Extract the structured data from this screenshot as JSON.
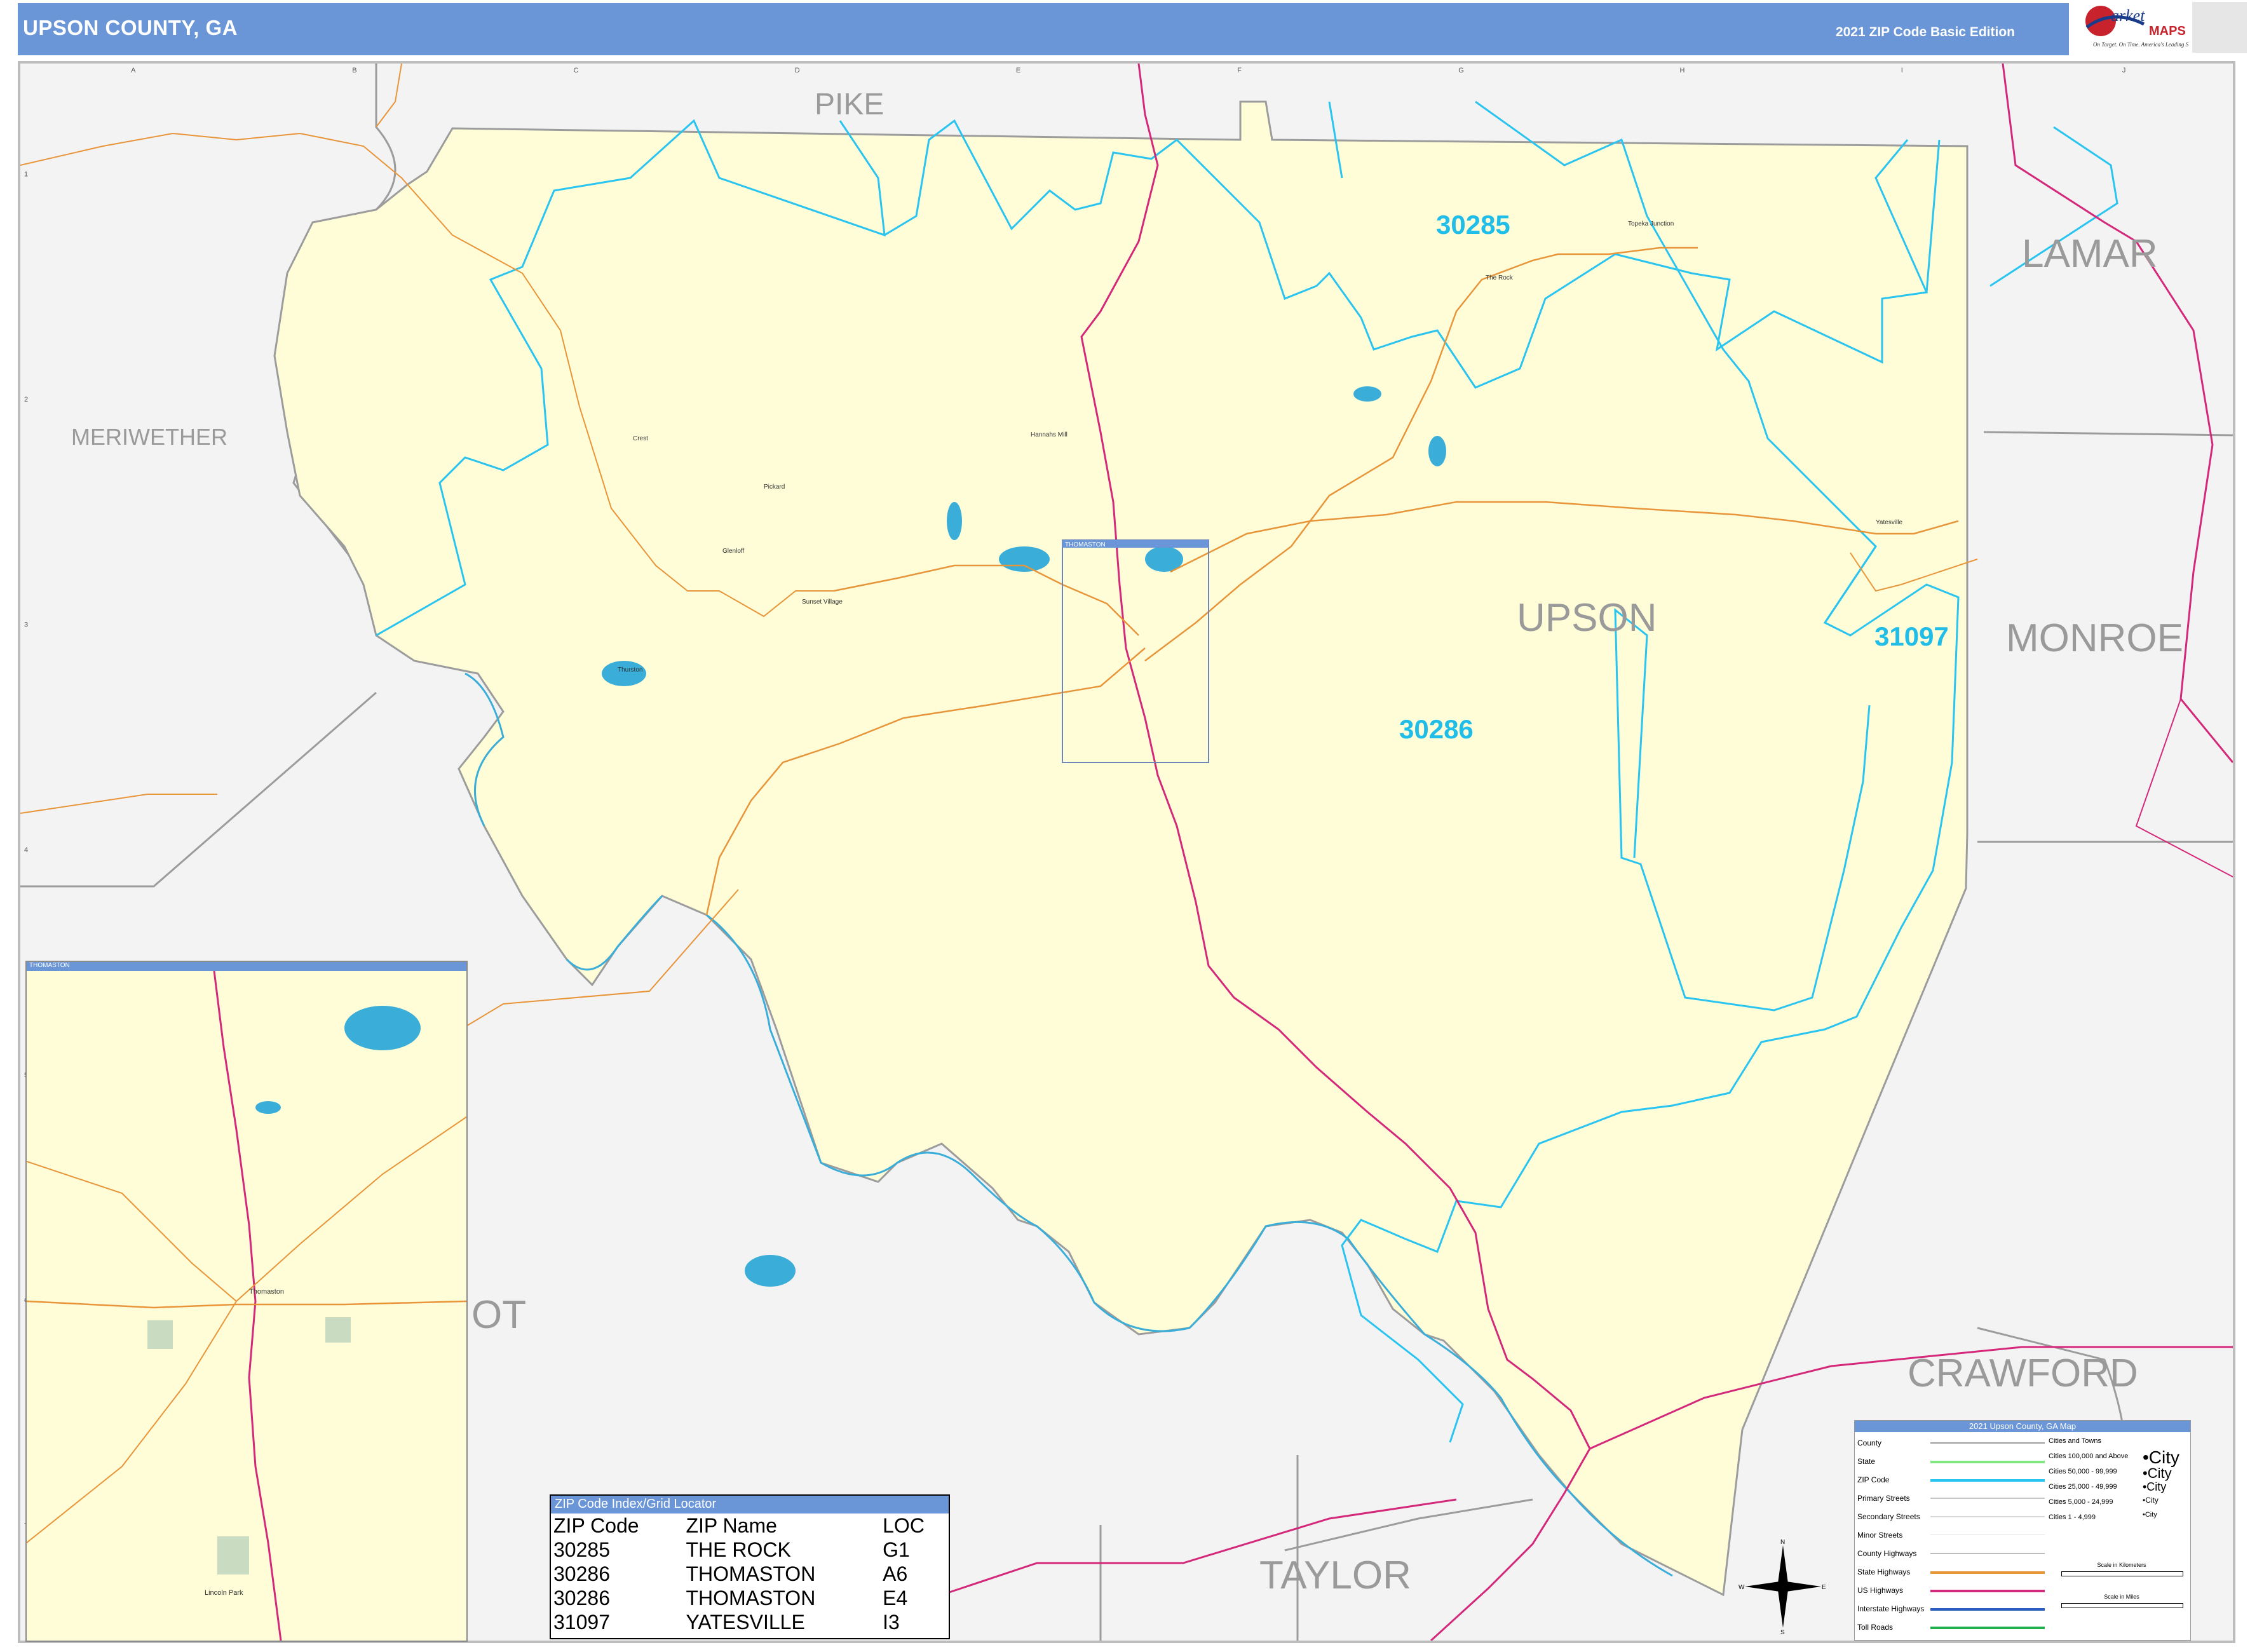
{
  "header": {
    "title": "UPSON COUNTY, GA",
    "edition": "2021 ZIP Code Basic Edition",
    "logo_text": "Market MAPS",
    "logo_tagline": "On Target. On Time. America's Leading Source of Business Maps"
  },
  "grid": {
    "columns": [
      "A",
      "B",
      "C",
      "D",
      "E",
      "F",
      "G",
      "H",
      "I",
      "J"
    ],
    "rows": [
      "1",
      "2",
      "3",
      "4",
      "5",
      "6",
      "7"
    ]
  },
  "counties": {
    "pike": "PIKE",
    "lamar": "LAMAR",
    "meriwether": "MERIWETHER",
    "upson": "UPSON",
    "monroe": "MONROE",
    "crawford": "CRAWFORD",
    "taylor": "TAYLOR",
    "talbot_partial": "OT"
  },
  "zips": {
    "z30285": "30285",
    "z31097": "31097",
    "z30286": "30286"
  },
  "towns": {
    "topeka_junction": "Topeka Junction",
    "the_rock": "The Rock",
    "hannahs_mill": "Hannahs Mill",
    "crest": "Crest",
    "pickard": "Pickard",
    "glenloff": "Glenloff",
    "sunset_village": "Sunset Village",
    "thurston": "Thurston",
    "yatesville": "Yatesville",
    "thomaston": "Thomaston",
    "lincoln_park": "Lincoln Park"
  },
  "inset": {
    "title": "THOMASTON",
    "box_label": "THOMASTON"
  },
  "zip_index": {
    "title": "ZIP Code Index/Grid Locator",
    "headers": [
      "ZIP Code",
      "ZIP Name",
      "LOC"
    ],
    "rows": [
      [
        "30285",
        "THE ROCK",
        "G1"
      ],
      [
        "30286",
        "THOMASTON",
        "A6"
      ],
      [
        "30286",
        "THOMASTON",
        "E4"
      ],
      [
        "31097",
        "YATESVILLE",
        "I3"
      ]
    ]
  },
  "legend": {
    "title": "2021 Upson County, GA Map",
    "items": [
      "County",
      "State",
      "ZIP Code",
      "Primary Streets",
      "Secondary Streets",
      "Minor Streets",
      "County Highways",
      "State Highways",
      "US Highways",
      "Interstate Highways",
      "Toll Roads"
    ],
    "cities_title": "Cities and Towns",
    "cities": [
      {
        "range": "Cities 100,000 and Above",
        "sample": "•City"
      },
      {
        "range": "Cities 50,000 - 99,999",
        "sample": "•City"
      },
      {
        "range": "Cities 25,000 - 49,999",
        "sample": "•City"
      },
      {
        "range": "Cities 5,000 - 24,999",
        "sample": "•City"
      },
      {
        "range": "Cities 1 - 4,999",
        "sample": "•City"
      }
    ],
    "scale_km": "Scale in Kilometers",
    "scale_mi": "Scale in Miles"
  },
  "compass": {
    "n": "N",
    "s": "S",
    "e": "E",
    "w": "W"
  },
  "colors": {
    "header": "#6a96d8",
    "county_fill": "#fefdd8",
    "zip_boundary": "#29c4f0",
    "us_highway": "#d4287b",
    "state_highway": "#e8953a",
    "water": "#3aaed8",
    "county_label": "#9a9a9a",
    "zip_label": "#1fbde8"
  }
}
